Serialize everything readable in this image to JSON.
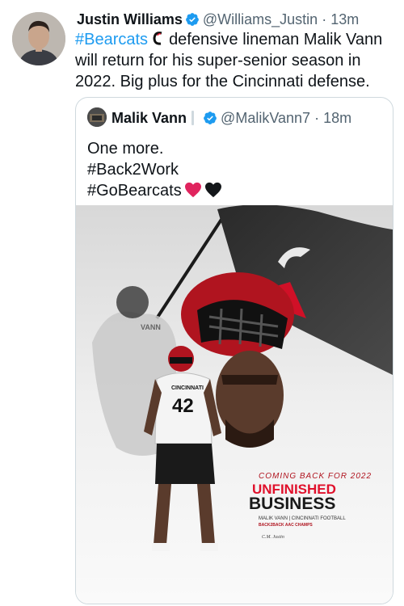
{
  "tweet": {
    "author_name": "Justin Williams",
    "author_handle": "@Williams_Justin",
    "separator": "·",
    "time": "13m",
    "hashtag": "#Bearcats",
    "text_after_logo": "defensive lineman Malik Vann",
    "text_line2": "will return for his super-senior season in",
    "text_line3": "2022. Big plus for the Cincinnati defense."
  },
  "quoted_tweet": {
    "author_name": "Malik Vann",
    "author_handle": "@MalikVann7",
    "separator": "·",
    "time": "18m",
    "line1": "One more.",
    "line2": "#Back2Work",
    "line3": "#GoBearcats"
  },
  "graphic": {
    "subtitle": "COMING BACK FOR 2022",
    "title_line1": "UNFINISHED",
    "title_line2": "BUSINESS",
    "credit_line": "MALIK VANN | CINCINNATI FOOTBALL",
    "credit_sub": "BACK2BACK AAC CHAMPS",
    "jersey_number": "42",
    "jersey_name": "VANN",
    "jersey_brand": "CINCINNATI",
    "signature": "C.M. Justin"
  },
  "colors": {
    "link": "#1d9bf0",
    "red": "#e0102b",
    "heart_red": "#e0245e",
    "heart_black": "#14171a"
  }
}
